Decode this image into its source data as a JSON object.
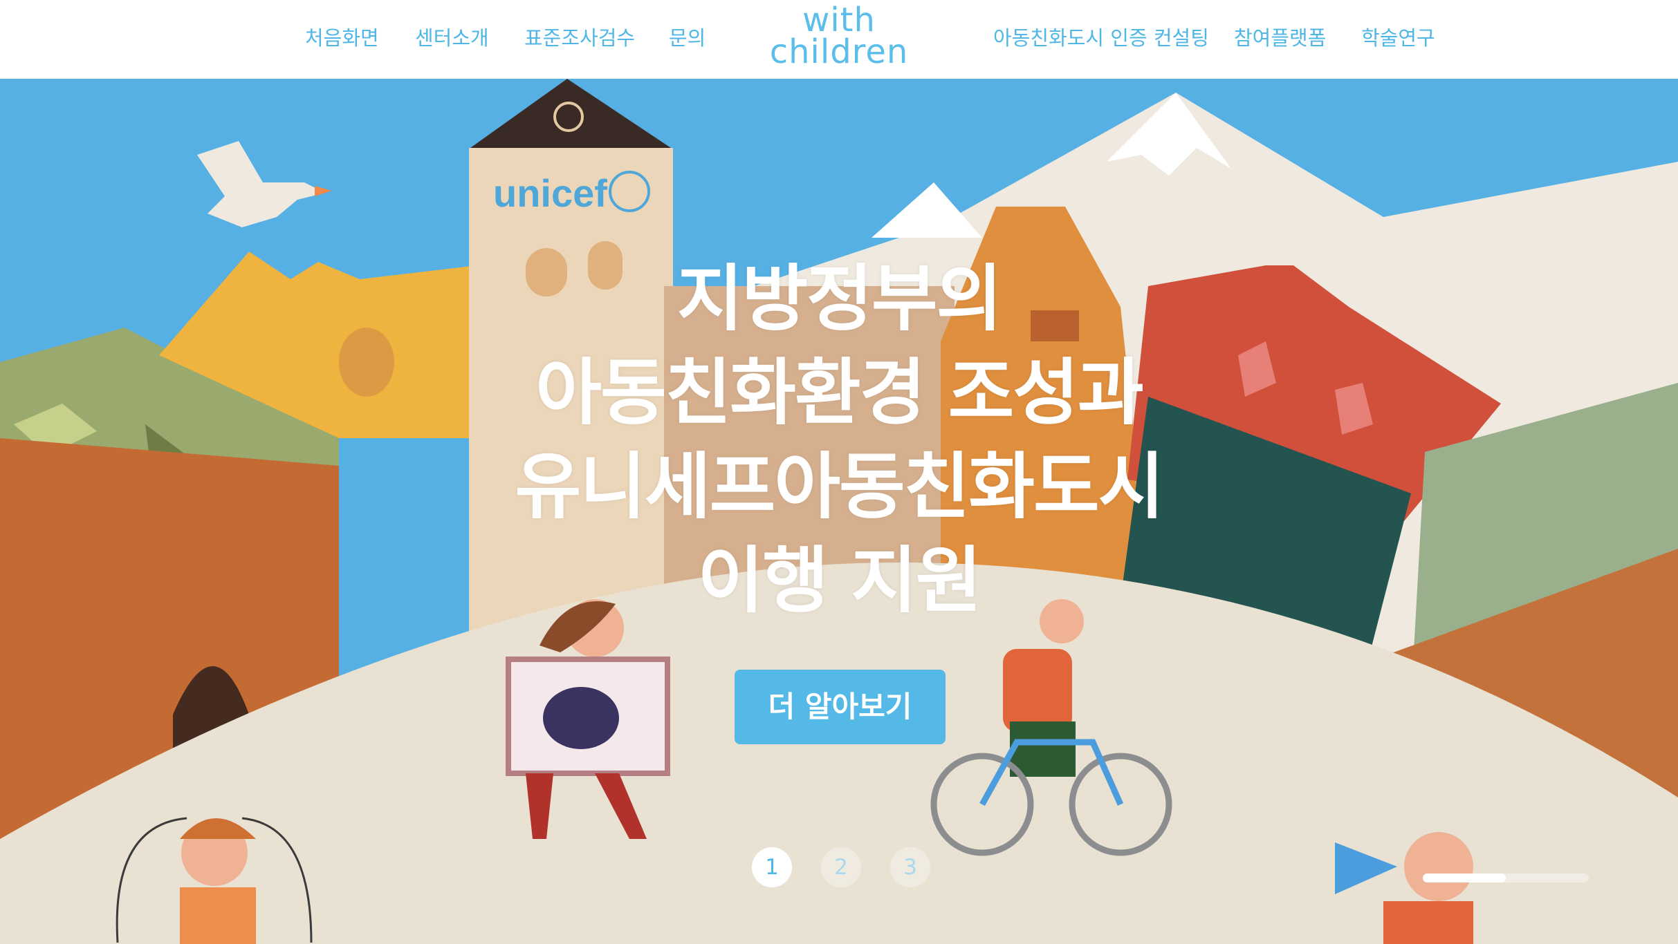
{
  "nav": {
    "left": [
      {
        "label": "처음화면"
      },
      {
        "label": "센터소개"
      },
      {
        "label": "표준조사검수"
      },
      {
        "label": "문의"
      }
    ],
    "right": [
      {
        "label": "아동친화도시 인증 컨설팅"
      },
      {
        "label": "참여플랫폼"
      },
      {
        "label": "학술연구"
      }
    ]
  },
  "logo": {
    "line1": "with",
    "line2": "children"
  },
  "hero": {
    "headline": [
      "지방정부의",
      "아동친화환경 조성과",
      "유니세프아동친화도시",
      "이행 지원"
    ],
    "sign_text": "unicef",
    "cta_label": "더 알아보기"
  },
  "slider": {
    "dots": [
      "1",
      "2",
      "3"
    ],
    "active_index": 0,
    "progress": 0.5
  },
  "colors": {
    "accent": "#4fb6e6",
    "sky": "#56b0e4",
    "ground": "#e9e1d2"
  }
}
